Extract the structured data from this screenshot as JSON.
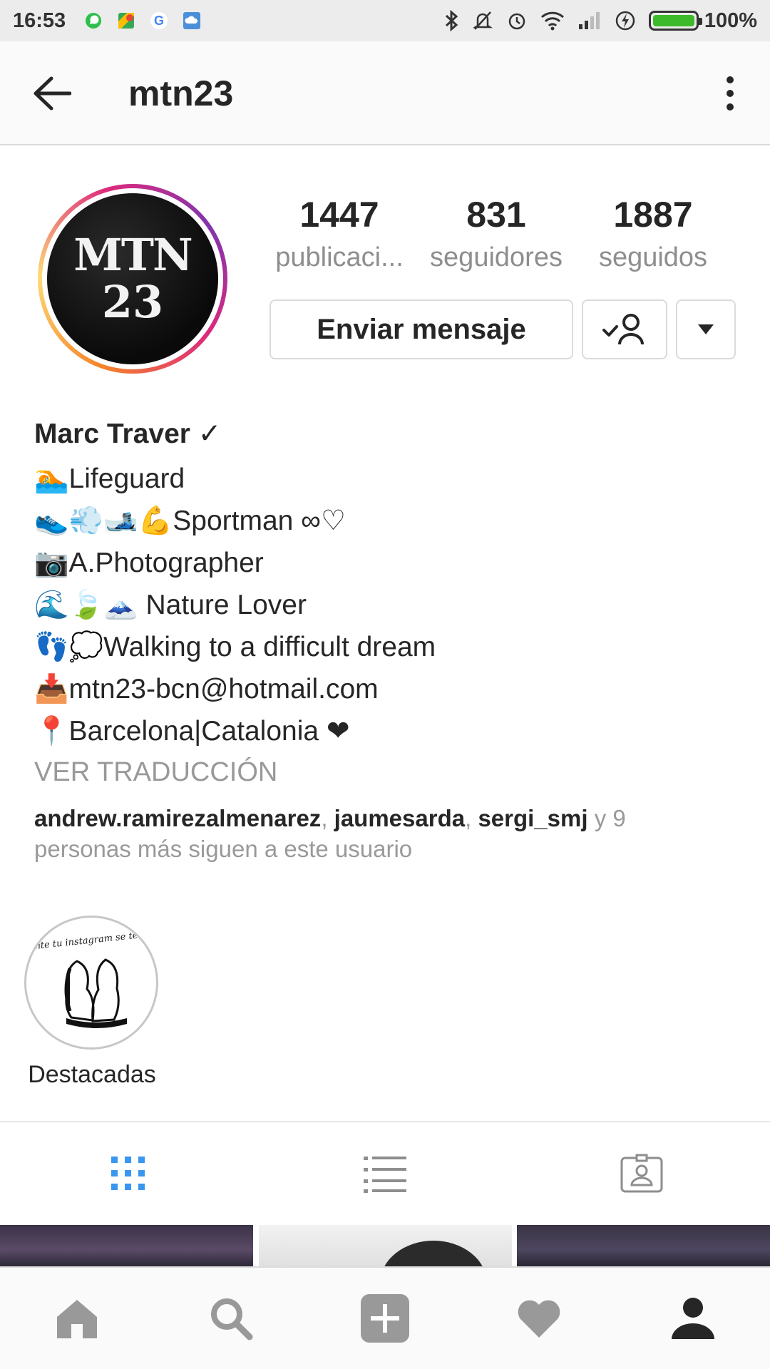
{
  "status_bar": {
    "time": "16:53",
    "battery": "100%",
    "left_icons": [
      "whatsapp-icon",
      "maps-icon",
      "google-icon",
      "cloud-icon"
    ],
    "right_icons": [
      "bluetooth-icon",
      "mute-icon",
      "alarm-icon",
      "wifi-icon",
      "signal-icon",
      "charging-icon",
      "battery-icon"
    ]
  },
  "app_bar": {
    "title": "mtn23"
  },
  "profile": {
    "avatar_text_line1": "MTN",
    "avatar_text_line2": "23",
    "stats": [
      {
        "value": "1447",
        "label": "publicaci..."
      },
      {
        "value": "831",
        "label": "seguidores"
      },
      {
        "value": "1887",
        "label": "seguidos"
      }
    ],
    "message_button": "Enviar mensaje",
    "name": "Marc Traver ✓",
    "bio_lines": [
      "🏊Lifeguard",
      "👟💨🎿💪Sportman ∞♡",
      "📷A.Photographer",
      "🌊🍃🗻 Nature Lover",
      "👣💭Walking to a difficult dream",
      "📥mtn23-bcn@hotmail.com",
      "📍Barcelona|Catalonia ❤"
    ],
    "translate_link": "VER TRADUCCIÓN",
    "followed_by": {
      "user1": "andrew.ramirezalmenarez",
      "sep1": ", ",
      "user2": "jaumesarda",
      "sep2": ", ",
      "user3": "sergi_smj",
      "rest": " y 9",
      "line2": "personas más siguen a este usuario"
    }
  },
  "highlights": [
    {
      "label": "Destacadas",
      "caption": "o tia, no ente tu instagram se te ve tan feliz..."
    }
  ],
  "tabs": [
    "grid-icon",
    "list-icon",
    "tagged-icon"
  ],
  "colors": {
    "active_tab": "#3897f0",
    "inactive_icon": "#999999",
    "heart": "#e0457b",
    "check_green": "#3cba2c"
  },
  "bottom_nav": [
    "home-icon",
    "search-icon",
    "add-icon",
    "heart-icon",
    "profile-icon"
  ]
}
